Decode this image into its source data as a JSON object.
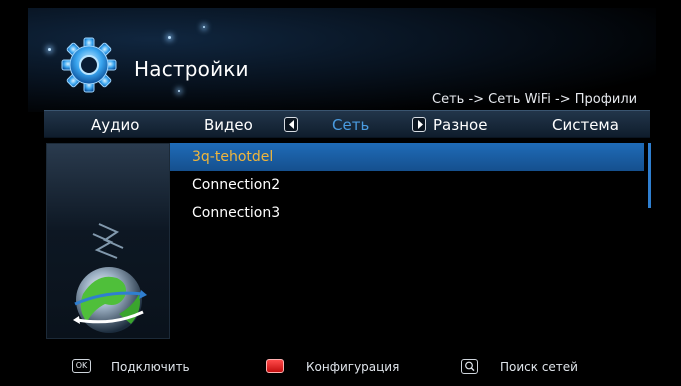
{
  "header": {
    "title": "Настройки",
    "breadcrumb": "Сеть -> Сеть WiFi -> Профили"
  },
  "tabs": [
    {
      "label": "Аудио",
      "active": false
    },
    {
      "label": "Видео",
      "active": false
    },
    {
      "label": "Сеть",
      "active": true
    },
    {
      "label": "Разное",
      "active": false
    },
    {
      "label": "Система",
      "active": false
    }
  ],
  "profiles": [
    {
      "name": "3q-tehotdel",
      "selected": true
    },
    {
      "name": "Connection2",
      "selected": false
    },
    {
      "name": "Connection3",
      "selected": false
    }
  ],
  "footer": {
    "ok_key": "OK",
    "connect_label": "Подключить",
    "config_label": "Конфигурация",
    "search_label": "Поиск сетей"
  },
  "colors": {
    "active_tab": "#4a9be0",
    "selected_row": "#1f6cb8",
    "selected_text": "#f0b63c",
    "red_key": "#e01a1a"
  },
  "icons": [
    "gear-icon",
    "network-globe-icon",
    "arrow-left-icon",
    "arrow-right-icon",
    "ok-key-icon",
    "red-key-icon",
    "search-key-icon"
  ]
}
